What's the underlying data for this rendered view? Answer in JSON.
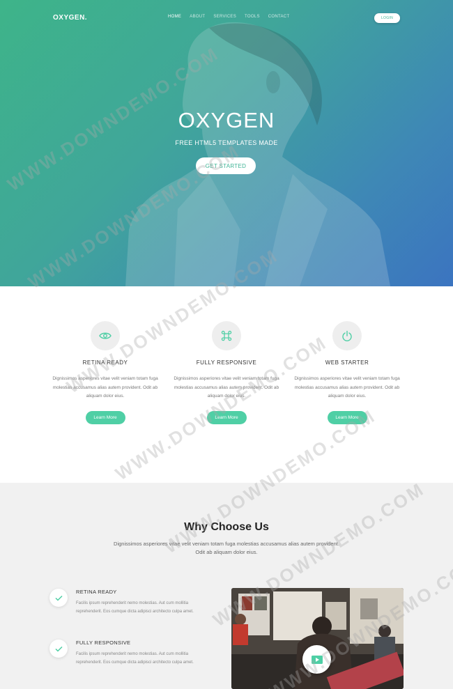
{
  "header": {
    "logo": "OXYGEN.",
    "nav": [
      "HOME",
      "ABOUT",
      "SERVICES",
      "TOOLS",
      "CONTACT"
    ],
    "login_label": "LOGIN"
  },
  "hero": {
    "title": "OXYGEN",
    "subtitle": "FREE HTML5 TEMPLATES MADE",
    "cta_label": "GET STARTED"
  },
  "features": [
    {
      "icon": "eye-icon",
      "title": "RETINA READY",
      "desc": "Dignissimos asperiores vitae velit veniam totam fuga molestias accusamus alias autem provident. Odit ab aliquam dolor eius.",
      "button": "Learn More"
    },
    {
      "icon": "command-icon",
      "title": "FULLY RESPONSIVE",
      "desc": "Dignissimos asperiores vitae velit veniam totam fuga molestias accusamus alias autem provident. Odit ab aliquam dolor eius.",
      "button": "Learn More"
    },
    {
      "icon": "power-icon",
      "title": "WEB STARTER",
      "desc": "Dignissimos asperiores vitae velit veniam totam fuga molestias accusamus alias autem provident. Odit ab aliquam dolor eius.",
      "button": "Learn More"
    }
  ],
  "why": {
    "title": "Why Choose Us",
    "subtitle": "Dignissimos asperiores vitae velit veniam totam fuga molestias accusamus alias autem provident. Odit ab aliquam dolor eius.",
    "items": [
      {
        "title": "RETINA READY",
        "desc": "Facilis ipsum reprehenderit nemo molestias. Aut cum mollitia reprehenderit. Eos cumque dicta adipisci architecto culpa amet."
      },
      {
        "title": "FULLY RESPONSIVE",
        "desc": "Facilis ipsum reprehenderit nemo molestias. Aut cum mollitia reprehenderit. Eos cumque dicta adipisci architecto culpa amet."
      }
    ]
  },
  "watermark": "WWW.DOWNDEMO.COM",
  "colors": {
    "accent": "#4fcfa5",
    "hero_start": "#3eb489",
    "hero_end": "#3b74c0",
    "section_bg": "#f1f1f1"
  }
}
